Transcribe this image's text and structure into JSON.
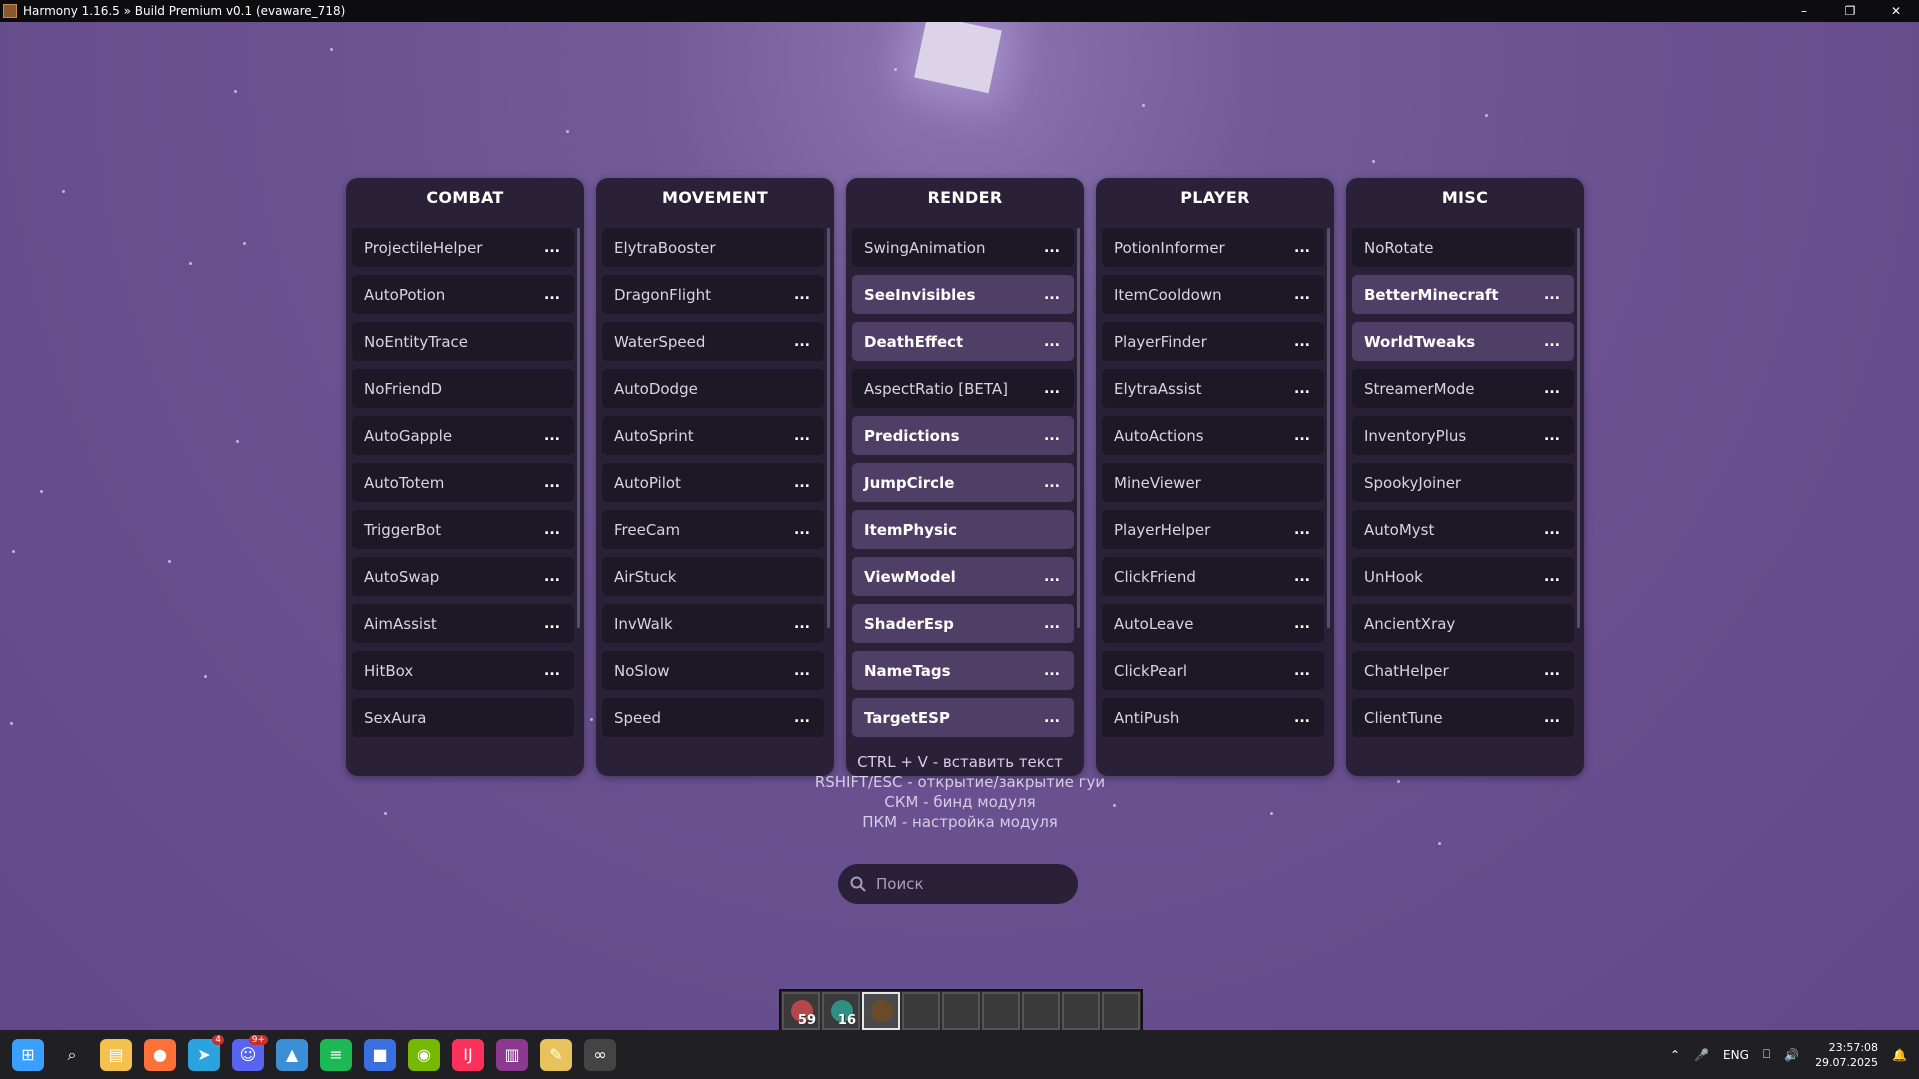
{
  "window": {
    "title": "Harmony 1.16.5 » Build Premium v0.1 (evaware_718)",
    "minimize_icon": "minimize-icon",
    "maximize_icon": "restore-icon",
    "close_icon": "close-icon"
  },
  "panels": [
    {
      "title": "COMBAT",
      "modules": [
        {
          "name": "ProjectileHelper",
          "active": false,
          "has_settings": true
        },
        {
          "name": "AutoPotion",
          "active": false,
          "has_settings": true
        },
        {
          "name": "NoEntityTrace",
          "active": false,
          "has_settings": false
        },
        {
          "name": "NoFriendD",
          "active": false,
          "has_settings": false
        },
        {
          "name": "AutoGapple",
          "active": false,
          "has_settings": true
        },
        {
          "name": "AutoTotem",
          "active": false,
          "has_settings": true
        },
        {
          "name": "TriggerBot",
          "active": false,
          "has_settings": true
        },
        {
          "name": "AutoSwap",
          "active": false,
          "has_settings": true
        },
        {
          "name": "AimAssist",
          "active": false,
          "has_settings": true
        },
        {
          "name": "HitBox",
          "active": false,
          "has_settings": true
        },
        {
          "name": "SexAura",
          "active": false,
          "has_settings": false
        }
      ]
    },
    {
      "title": "MOVEMENT",
      "modules": [
        {
          "name": "ElytraBooster",
          "active": false,
          "has_settings": false
        },
        {
          "name": "DragonFlight",
          "active": false,
          "has_settings": true
        },
        {
          "name": "WaterSpeed",
          "active": false,
          "has_settings": true
        },
        {
          "name": "AutoDodge",
          "active": false,
          "has_settings": false
        },
        {
          "name": "AutoSprint",
          "active": false,
          "has_settings": true
        },
        {
          "name": "AutoPilot",
          "active": false,
          "has_settings": true
        },
        {
          "name": "FreeCam",
          "active": false,
          "has_settings": true
        },
        {
          "name": "AirStuck",
          "active": false,
          "has_settings": false
        },
        {
          "name": "InvWalk",
          "active": false,
          "has_settings": true
        },
        {
          "name": "NoSlow",
          "active": false,
          "has_settings": true
        },
        {
          "name": "Speed",
          "active": false,
          "has_settings": true
        }
      ]
    },
    {
      "title": "RENDER",
      "modules": [
        {
          "name": "SwingAnimation",
          "active": false,
          "has_settings": true
        },
        {
          "name": "SeeInvisibles",
          "active": true,
          "has_settings": true
        },
        {
          "name": "DeathEffect",
          "active": true,
          "has_settings": true
        },
        {
          "name": "AspectRatio [BETA]",
          "active": false,
          "has_settings": true
        },
        {
          "name": "Predictions",
          "active": true,
          "has_settings": true
        },
        {
          "name": "JumpCircle",
          "active": true,
          "has_settings": true
        },
        {
          "name": "ItemPhysic",
          "active": true,
          "has_settings": false
        },
        {
          "name": "ViewModel",
          "active": true,
          "has_settings": true
        },
        {
          "name": "ShaderEsp",
          "active": true,
          "has_settings": true
        },
        {
          "name": "NameTags",
          "active": true,
          "has_settings": true
        },
        {
          "name": "TargetESP",
          "active": true,
          "has_settings": true
        }
      ]
    },
    {
      "title": "PLAYER",
      "modules": [
        {
          "name": "PotionInformer",
          "active": false,
          "has_settings": true
        },
        {
          "name": "ItemCooldown",
          "active": false,
          "has_settings": true
        },
        {
          "name": "PlayerFinder",
          "active": false,
          "has_settings": true
        },
        {
          "name": "ElytraAssist",
          "active": false,
          "has_settings": true
        },
        {
          "name": "AutoActions",
          "active": false,
          "has_settings": true
        },
        {
          "name": "MineViewer",
          "active": false,
          "has_settings": false
        },
        {
          "name": "PlayerHelper",
          "active": false,
          "has_settings": true
        },
        {
          "name": "ClickFriend",
          "active": false,
          "has_settings": true
        },
        {
          "name": "AutoLeave",
          "active": false,
          "has_settings": true
        },
        {
          "name": "ClickPearl",
          "active": false,
          "has_settings": true
        },
        {
          "name": "AntiPush",
          "active": false,
          "has_settings": true
        }
      ]
    },
    {
      "title": "MISC",
      "modules": [
        {
          "name": "NoRotate",
          "active": false,
          "has_settings": false
        },
        {
          "name": "BetterMinecraft",
          "active": true,
          "has_settings": true
        },
        {
          "name": "WorldTweaks",
          "active": true,
          "has_settings": true
        },
        {
          "name": "StreamerMode",
          "active": false,
          "has_settings": true
        },
        {
          "name": "InventoryPlus",
          "active": false,
          "has_settings": true
        },
        {
          "name": "SpookyJoiner",
          "active": false,
          "has_settings": false
        },
        {
          "name": "AutoMyst",
          "active": false,
          "has_settings": true
        },
        {
          "name": "UnHook",
          "active": false,
          "has_settings": true
        },
        {
          "name": "AncientXray",
          "active": false,
          "has_settings": false
        },
        {
          "name": "ChatHelper",
          "active": false,
          "has_settings": true
        },
        {
          "name": "ClientTune",
          "active": false,
          "has_settings": true
        }
      ]
    }
  ],
  "settings_label": "...",
  "hints": [
    "CTRL + V - вставить текст",
    "RSHIFT/ESC - открытие/закрытие гуи",
    "СКМ - бинд модуля",
    "ПКМ - настройка модуля"
  ],
  "search": {
    "placeholder": "Поиск",
    "icon": "search-icon"
  },
  "hotbar": {
    "selected_index": 2,
    "slots": [
      {
        "count": "59",
        "color": "#b5474a"
      },
      {
        "count": "16",
        "color": "#2f8f86"
      },
      {
        "count": "",
        "color": "#6b4a2a"
      },
      {
        "count": "",
        "color": ""
      },
      {
        "count": "",
        "color": ""
      },
      {
        "count": "",
        "color": ""
      },
      {
        "count": "",
        "color": ""
      },
      {
        "count": "",
        "color": ""
      },
      {
        "count": "",
        "color": ""
      }
    ]
  },
  "taskbar": {
    "apps": [
      {
        "name": "windows-start-icon",
        "color": "#3aa0ff",
        "badge": ""
      },
      {
        "name": "search-icon",
        "color": "",
        "badge": ""
      },
      {
        "name": "file-explorer-icon",
        "color": "#f2c14e",
        "badge": ""
      },
      {
        "name": "firefox-icon",
        "color": "#ff7139",
        "badge": ""
      },
      {
        "name": "telegram-icon",
        "color": "#2aa3df",
        "badge": "4"
      },
      {
        "name": "discord-icon",
        "color": "#5865f2",
        "badge": "9+"
      },
      {
        "name": "photos-icon",
        "color": "#3b8fd6",
        "badge": ""
      },
      {
        "name": "spotify-icon",
        "color": "#1db954",
        "badge": ""
      },
      {
        "name": "roblox-icon",
        "color": "#3a6fe0",
        "badge": ""
      },
      {
        "name": "nvidia-icon",
        "color": "#76b900",
        "badge": ""
      },
      {
        "name": "intellij-icon",
        "color": "#fe315d",
        "badge": ""
      },
      {
        "name": "winrar-icon",
        "color": "#8b3a8f",
        "badge": ""
      },
      {
        "name": "notes-icon",
        "color": "#e8c25a",
        "badge": ""
      },
      {
        "name": "minecraft-icon",
        "color": "#444",
        "badge": ""
      }
    ],
    "tray": {
      "language": "ENG",
      "time": "23:57:08",
      "date": "29.07.2025"
    }
  }
}
